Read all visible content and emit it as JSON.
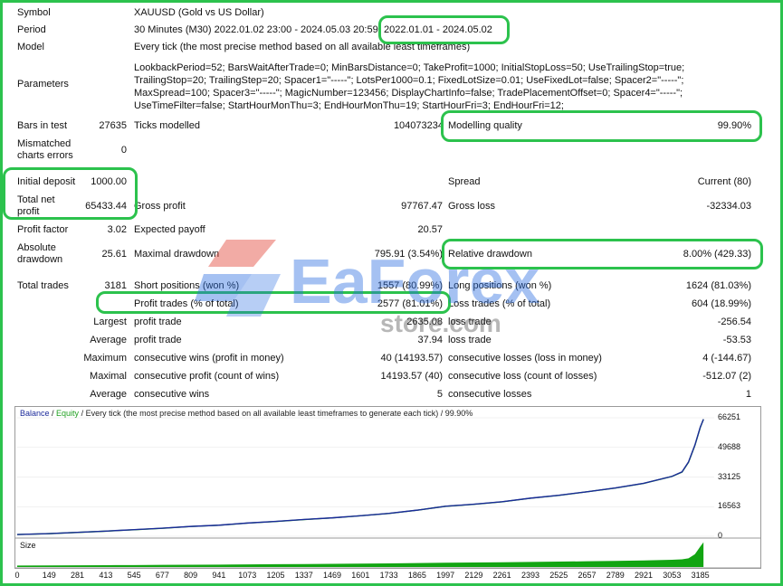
{
  "report": {
    "symbol": {
      "label": "Symbol",
      "value": "XAUUSD (Gold vs US Dollar)"
    },
    "period": {
      "label": "Period",
      "value": "30 Minutes (M30) 2022.01.02 23:00 - 2024.05.03 20:59",
      "range": "2022.01.01 - 2024.05.02"
    },
    "model": {
      "label": "Model",
      "value": "Every tick (the most precise method based on all available least timeframes)"
    },
    "parameters": {
      "label": "Parameters",
      "lines": [
        "LookbackPeriod=52; BarsWaitAfterTrade=0; MinBarsDistance=0; TakeProfit=1000; InitialStopLoss=50; UseTrailingStop=true;",
        "TrailingStop=20; TrailingStep=20; Spacer1=\"-----\"; LotsPer1000=0.1; FixedLotSize=0.01; UseFixedLot=false; Spacer2=\"-----\";",
        "MaxSpread=100; Spacer3=\"-----\"; MagicNumber=123456; DisplayChartInfo=false; TradePlacementOffset=0; Spacer4=\"-----\";",
        "UseTimeFilter=false; StartHourMonThu=3; EndHourMonThu=19; StartHourFri=3; EndHourFri=12;"
      ]
    },
    "bars_in_test": {
      "label": "Bars in test",
      "value": "27635"
    },
    "ticks_modelled": {
      "label": "Ticks modelled",
      "value": "104073234"
    },
    "modelling_quality": {
      "label": "Modelling quality",
      "value": "99.90%"
    },
    "mismatched": {
      "label_1": "Mismatched",
      "label_2": "charts errors",
      "value": "0"
    },
    "initial_deposit": {
      "label": "Initial deposit",
      "value": "1000.00"
    },
    "spread": {
      "label": "Spread",
      "value": "Current (80)"
    },
    "total_net_profit": {
      "label_1": "Total net",
      "label_2": "profit",
      "value": "65433.44"
    },
    "gross_profit": {
      "label": "Gross profit",
      "value": "97767.47"
    },
    "gross_loss": {
      "label": "Gross loss",
      "value": "-32334.03"
    },
    "profit_factor": {
      "label": "Profit factor",
      "value": "3.02"
    },
    "expected_payoff": {
      "label": "Expected payoff",
      "value": "20.57"
    },
    "absolute_drawdown": {
      "label_1": "Absolute",
      "label_2": "drawdown",
      "value": "25.61"
    },
    "maximal_drawdown": {
      "label": "Maximal drawdown",
      "value": "795.91 (3.54%)"
    },
    "relative_drawdown": {
      "label": "Relative drawdown",
      "value": "8.00% (429.33)"
    },
    "total_trades": {
      "label": "Total trades",
      "value": "3181"
    },
    "short_positions": {
      "label": "Short positions (won %)",
      "value": "1557 (80.99%)"
    },
    "long_positions": {
      "label": "Long positions (won %)",
      "value": "1624 (81.03%)"
    },
    "profit_trades": {
      "label": "Profit trades (% of total)",
      "value": "2577 (81.01%)"
    },
    "loss_trades": {
      "label": "Loss trades (% of total)",
      "value": "604 (18.99%)"
    },
    "largest": {
      "label": "Largest",
      "profit_label": "profit trade",
      "profit_value": "2635.08",
      "loss_label": "loss trade",
      "loss_value": "-256.54"
    },
    "average": {
      "label": "Average",
      "profit_label": "profit trade",
      "profit_value": "37.94",
      "loss_label": "loss trade",
      "loss_value": "-53.53"
    },
    "maximum": {
      "label": "Maximum",
      "profit_label": "consecutive wins (profit in money)",
      "profit_value": "40 (14193.57)",
      "loss_label": "consecutive losses (loss in money)",
      "loss_value": "4 (-144.67)"
    },
    "maximal": {
      "label": "Maximal",
      "profit_label": "consecutive profit (count of wins)",
      "profit_value": "14193.57 (40)",
      "loss_label": "consecutive loss (count of losses)",
      "loss_value": "-512.07 (2)"
    },
    "average_consec": {
      "label": "Average",
      "profit_label": "consecutive wins",
      "profit_value": "5",
      "loss_label": "consecutive losses",
      "loss_value": "1"
    }
  },
  "watermark": {
    "brand": "EaForex",
    "sub": "store.com"
  },
  "colors": {
    "highlight": "#2cc24d",
    "balance": "#1b2a9a",
    "equity": "#20a020",
    "size_fill": "#12a512"
  },
  "chart_data": {
    "type": "area",
    "legend": {
      "balance": "Balance",
      "sep": " / ",
      "equity": "Equity",
      "desc": " / Every tick (the most precise method based on all available least timeframes to generate each tick) / 99.90%"
    },
    "x_ticks": [
      0,
      149,
      281,
      413,
      545,
      677,
      809,
      941,
      1073,
      1205,
      1337,
      1469,
      1601,
      1733,
      1865,
      1997,
      2129,
      2261,
      2393,
      2525,
      2657,
      2789,
      2921,
      3053,
      3185
    ],
    "y_ticks": [
      0,
      16563,
      33125,
      49688,
      66251
    ],
    "xlim": [
      0,
      3250
    ],
    "ylim": [
      0,
      66251
    ],
    "size_label": "Size",
    "series": [
      {
        "name": "Balance",
        "x": [
          0,
          149,
          281,
          413,
          545,
          677,
          809,
          941,
          1073,
          1205,
          1337,
          1469,
          1601,
          1733,
          1865,
          1997,
          2129,
          2261,
          2393,
          2525,
          2657,
          2789,
          2921,
          3053,
          3100,
          3130,
          3160,
          3185,
          3200
        ],
        "y": [
          1000,
          1500,
          2200,
          2900,
          3700,
          4500,
          5500,
          6200,
          7400,
          8300,
          9400,
          10300,
          11500,
          12800,
          14600,
          16800,
          17900,
          19300,
          21300,
          22900,
          24900,
          27000,
          29600,
          33500,
          36000,
          41500,
          51000,
          61000,
          65433
        ]
      },
      {
        "name": "Equity",
        "x": [
          0,
          149,
          281,
          413,
          545,
          677,
          809,
          941,
          1073,
          1205,
          1337,
          1469,
          1601,
          1733,
          1865,
          1997,
          2129,
          2261,
          2393,
          2525,
          2657,
          2789,
          2921,
          3053,
          3100,
          3130,
          3160,
          3185,
          3200
        ],
        "y": [
          1000,
          1450,
          2150,
          2850,
          3650,
          4450,
          5450,
          6150,
          7350,
          8250,
          9350,
          10250,
          11450,
          12750,
          14550,
          16750,
          17850,
          19250,
          21250,
          22850,
          24850,
          26950,
          29550,
          33450,
          35900,
          41300,
          50800,
          60800,
          65433
        ]
      }
    ]
  }
}
